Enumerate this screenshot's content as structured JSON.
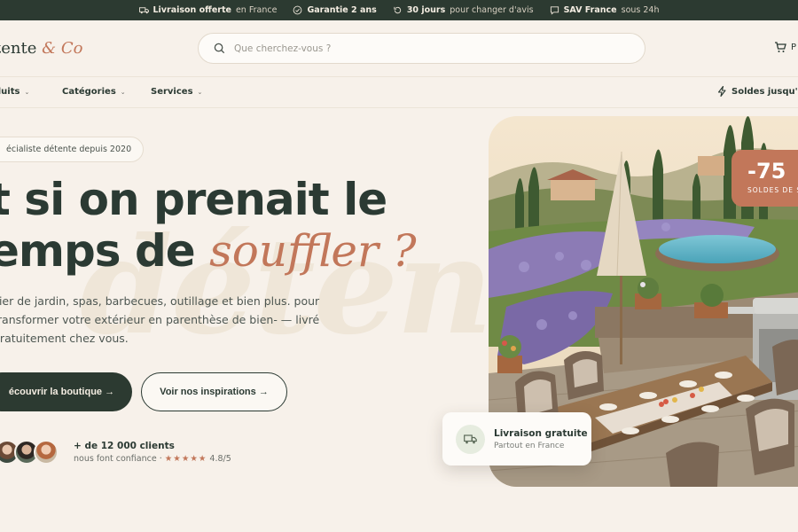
{
  "topbar": {
    "items": [
      {
        "bold": "Livraison offerte",
        "text": "en France",
        "icon": "truck-icon"
      },
      {
        "bold": "Garantie 2 ans",
        "text": "",
        "icon": "check-circle-icon"
      },
      {
        "bold": "30 jours",
        "text": "pour changer d'avis",
        "icon": "return-icon"
      },
      {
        "bold": "SAV France",
        "text": "sous 24h",
        "icon": "chat-icon"
      }
    ]
  },
  "header": {
    "logo_main": "tente",
    "logo_accent": "& Co",
    "search_placeholder": "Que cherchez-vous ?",
    "cart_label": "P"
  },
  "nav": {
    "items": [
      {
        "label": "duits"
      },
      {
        "label": "Catégories"
      },
      {
        "label": "Services"
      }
    ],
    "promo": "Soldes jusqu'à -"
  },
  "hero": {
    "badge": "écialiste détente depuis 2020",
    "title_line1": "t si on prenait le",
    "title_line2_start": "emps de ",
    "title_line2_accent": "souffler ?",
    "watermark": "détente",
    "description": "ilier de jardin, spas, barbecues, outillage et bien plus. pour transformer votre extérieur en parenthèse de bien- — livré gratuitement chez vous.",
    "cta_primary": "écouvrir la boutique →",
    "cta_secondary": "Voir nos inspirations →",
    "social_count": "+ de 12 000 clients",
    "social_trust": "nous font confiance ·",
    "stars": "★★★★★",
    "rating": "4.8/5"
  },
  "promo_badge": {
    "percent": "-75",
    "label": "SOLDES DE S"
  },
  "delivery_card": {
    "title": "Livraison gratuite",
    "subtitle": "Partout en France"
  },
  "colors": {
    "dark_green": "#2c3a31",
    "terracotta": "#c2775a",
    "cream": "#f7f1ea"
  }
}
